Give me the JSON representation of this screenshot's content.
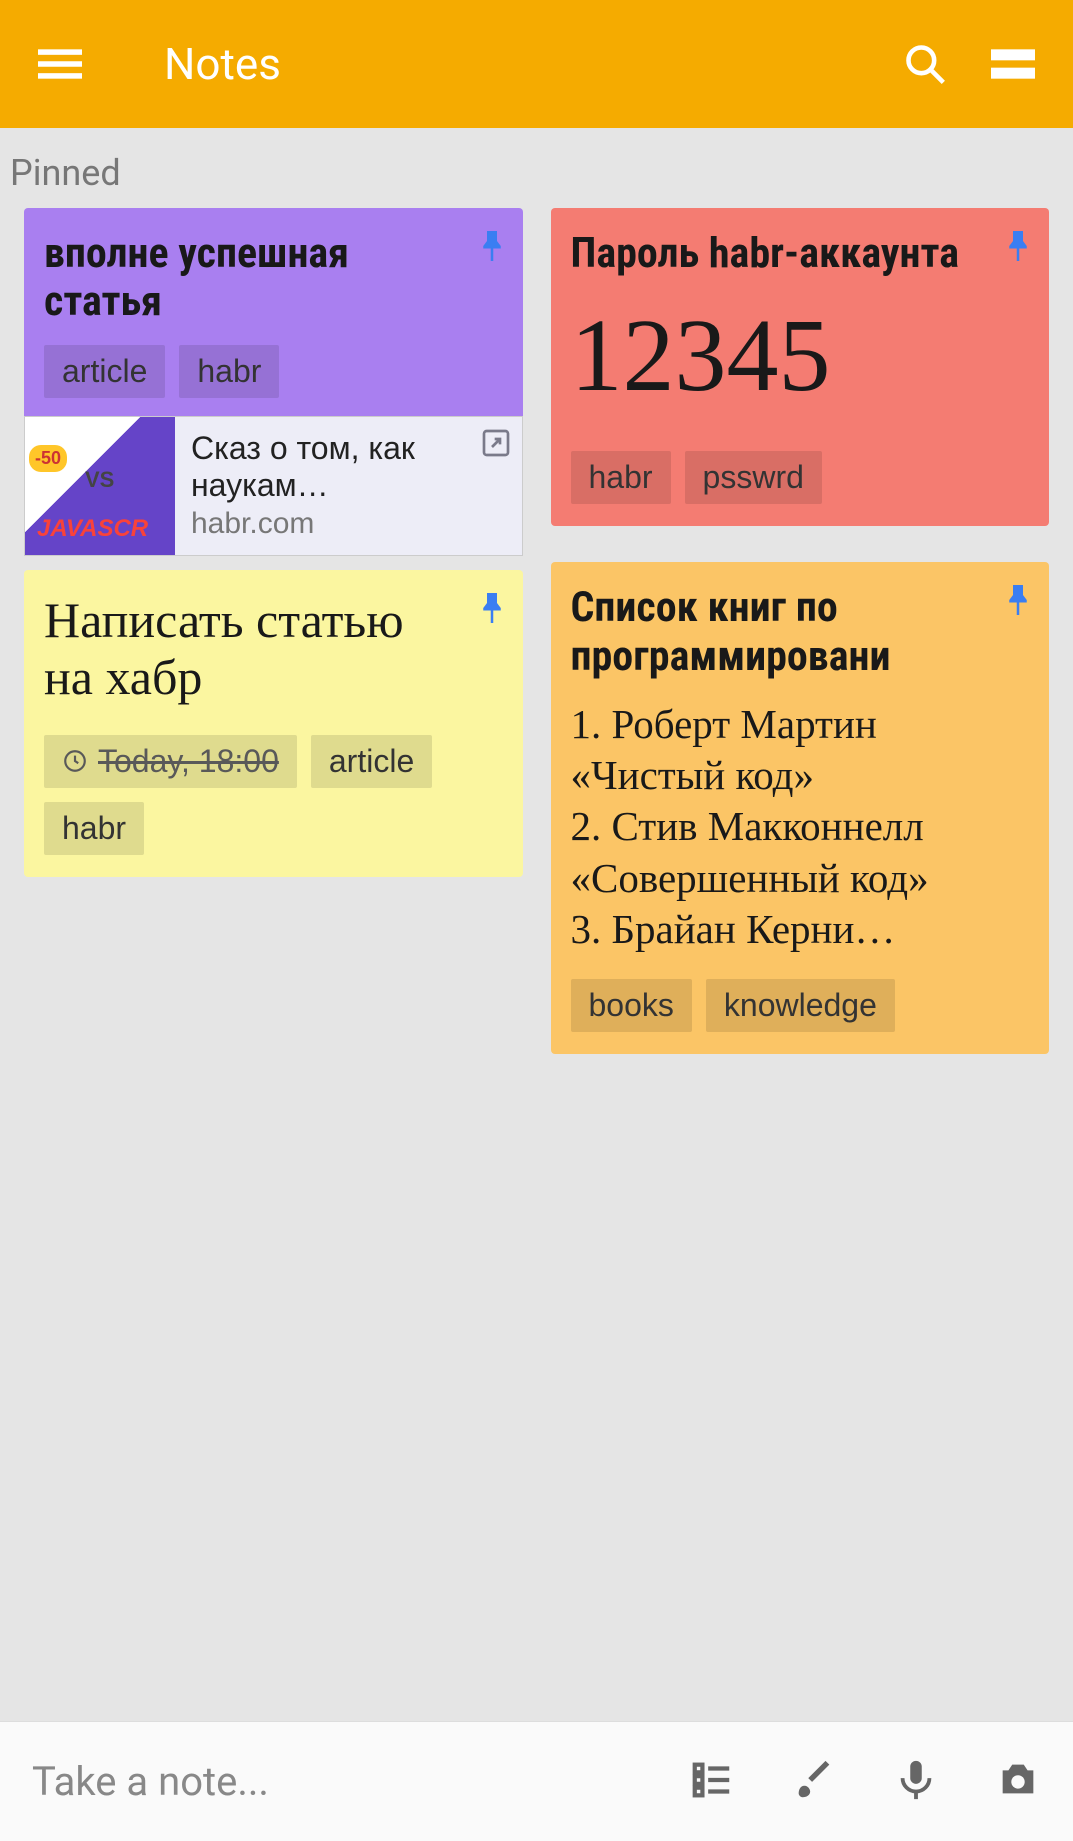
{
  "header": {
    "title": "Notes"
  },
  "section": {
    "pinned": "Pinned"
  },
  "notes": {
    "n1": {
      "title": "вполне успешная статья",
      "tags": [
        "article",
        "habr"
      ],
      "link": {
        "title": "Сказ о том, как наукам…",
        "domain": "habr.com",
        "thumb_badge": "-50",
        "thumb_vs": "VS",
        "thumb_js": "JAVASCR"
      }
    },
    "n2": {
      "title": "Написать статью на хабр",
      "reminder": "Today, 18:00",
      "tags": [
        "article",
        "habr"
      ]
    },
    "n3": {
      "title": "Пароль habr-аккаунта",
      "body": "12345",
      "tags": [
        "habr",
        "psswrd"
      ]
    },
    "n4": {
      "title": "Список книг по программировани",
      "body": "1. Роберт Мартин «Чистый код»\n2. Стив Макконнелл «Совершенный код»\n3. Брайан Керни…",
      "tags": [
        "books",
        "knowledge"
      ]
    }
  },
  "bottom": {
    "placeholder": "Take a note..."
  }
}
